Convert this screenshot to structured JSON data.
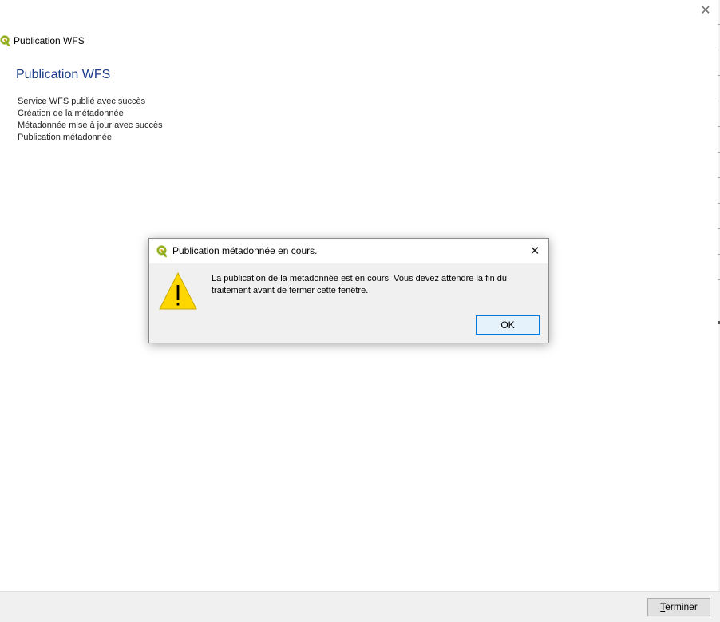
{
  "window": {
    "title": "Publication WFS",
    "heading": "Publication WFS",
    "close_symbol": "✕"
  },
  "status_lines": [
    "Service WFS publié avec succès",
    "Création de la métadonnée",
    "Métadonnée mise à jour avec succès",
    "Publication métadonnée"
  ],
  "footer": {
    "finish_accel": "T",
    "finish_rest": "erminer"
  },
  "dialog": {
    "title": "Publication métadonnée en cours.",
    "close_symbol": "✕",
    "message": "La publication de la métadonnée est en cours. Vous devez attendre la fin du traitement avant de fermer cette fenêtre.",
    "ok_label": "OK",
    "icon": "warning-icon"
  },
  "colors": {
    "heading": "#1a3c8c",
    "qgis_green": "#93b023",
    "warning_yellow": "#ffd700",
    "focus_border": "#0078d7"
  }
}
